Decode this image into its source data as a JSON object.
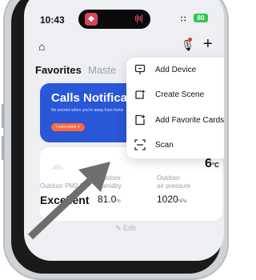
{
  "status_bar": {
    "time": "10:43",
    "battery": "80"
  },
  "header": {
    "icons": [
      "home-icon",
      "microphone-icon",
      "plus-icon"
    ]
  },
  "tabs": [
    {
      "label": "Favorites",
      "active": true
    },
    {
      "label": "Maste",
      "active": false
    }
  ],
  "banner": {
    "title": "Calls Notificat",
    "subtitle": "No worries when you're away from home",
    "button_label": "Learn more >"
  },
  "weather": {
    "temperature": "6",
    "temperature_unit": "°C",
    "items": [
      {
        "label_line1": "",
        "label_line2": "Outdoor PM2.5",
        "value": "Excellent",
        "unit": ""
      },
      {
        "label_line1": "Outdoor",
        "label_line2": "humidity",
        "value": "81.0",
        "unit": "%"
      },
      {
        "label_line1": "Outdoor",
        "label_line2": "air pressure",
        "value": "1020",
        "unit": "hPa"
      }
    ]
  },
  "edit_label": "Edit",
  "menu": {
    "items": [
      {
        "label": "Add Device",
        "icon": "add-device-icon"
      },
      {
        "label": "Create Scene",
        "icon": "create-scene-icon"
      },
      {
        "label": "Add Favorite Cards",
        "icon": "add-card-icon"
      },
      {
        "label": "Scan",
        "icon": "scan-icon"
      }
    ]
  },
  "colors": {
    "accent": "#2a56d8",
    "banner_button": "#ff6a3d",
    "arrow": "#6e6e6e"
  }
}
